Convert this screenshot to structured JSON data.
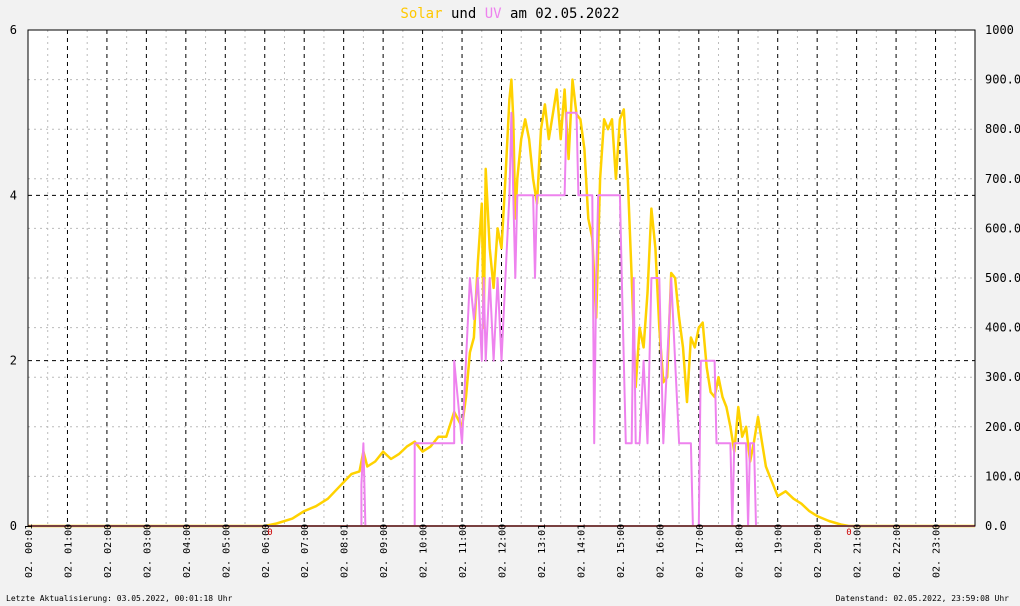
{
  "title": {
    "part1": "Solar",
    "part2": "und",
    "part3": "UV",
    "part4": "am 02.05.2022"
  },
  "footer": {
    "left": "Letzte Aktualisierung: 03.05.2022, 00:01:18 Uhr",
    "right": "Datenstand: 02.05.2022, 23:59:08 Uhr"
  },
  "colors": {
    "solar": "#ffd200",
    "uv": "#ee82ee",
    "title_solar": "#ffc800",
    "title_uv": "#ee82ee",
    "zero_marker": "#cc0000"
  },
  "chart_data": {
    "type": "line",
    "x_unit": "hours",
    "xlim": [
      0,
      24
    ],
    "x_tick_labels": [
      "02. 00:01",
      "02. 01:00",
      "02. 02:00",
      "02. 03:00",
      "02. 04:00",
      "02. 05:00",
      "02. 06:00",
      "02. 07:00",
      "02. 08:01",
      "02. 09:00",
      "02. 10:00",
      "02. 11:00",
      "02. 12:00",
      "02. 13:01",
      "02. 14:01",
      "02. 15:00",
      "02. 16:00",
      "02. 17:00",
      "02. 18:00",
      "02. 19:00",
      "02. 20:00",
      "02. 21:00",
      "02. 22:00",
      "02. 23:00"
    ],
    "y_left": {
      "lim": [
        0,
        6
      ],
      "ticks": [
        "0",
        "2",
        "4",
        "6"
      ]
    },
    "y_right": {
      "lim": [
        0,
        1000
      ],
      "ticks": [
        "0.0",
        "100.0",
        "200.0",
        "300.0",
        "400.0",
        "500.0",
        "600.0",
        "700.0",
        "800.0",
        "900.0",
        "1000"
      ]
    },
    "grid": true,
    "zero_markers": [
      "0",
      "0"
    ],
    "series": [
      {
        "name": "Solar",
        "axis": "right",
        "color": "#ffd200",
        "points": [
          [
            0,
            0
          ],
          [
            6.0,
            0
          ],
          [
            6.3,
            5
          ],
          [
            6.7,
            15
          ],
          [
            7.0,
            30
          ],
          [
            7.3,
            40
          ],
          [
            7.6,
            55
          ],
          [
            7.9,
            80
          ],
          [
            8.2,
            105
          ],
          [
            8.4,
            110
          ],
          [
            8.5,
            150
          ],
          [
            8.6,
            120
          ],
          [
            8.8,
            130
          ],
          [
            9.0,
            150
          ],
          [
            9.2,
            135
          ],
          [
            9.4,
            145
          ],
          [
            9.6,
            160
          ],
          [
            9.8,
            170
          ],
          [
            10.0,
            150
          ],
          [
            10.2,
            160
          ],
          [
            10.4,
            180
          ],
          [
            10.6,
            180
          ],
          [
            10.8,
            230
          ],
          [
            11.0,
            200
          ],
          [
            11.1,
            260
          ],
          [
            11.2,
            350
          ],
          [
            11.3,
            380
          ],
          [
            11.4,
            530
          ],
          [
            11.5,
            650
          ],
          [
            11.55,
            400
          ],
          [
            11.6,
            720
          ],
          [
            11.7,
            560
          ],
          [
            11.8,
            480
          ],
          [
            11.9,
            600
          ],
          [
            12.0,
            560
          ],
          [
            12.1,
            700
          ],
          [
            12.2,
            860
          ],
          [
            12.25,
            900
          ],
          [
            12.3,
            820
          ],
          [
            12.35,
            620
          ],
          [
            12.4,
            700
          ],
          [
            12.5,
            780
          ],
          [
            12.6,
            820
          ],
          [
            12.7,
            780
          ],
          [
            12.8,
            700
          ],
          [
            12.9,
            650
          ],
          [
            13.0,
            800
          ],
          [
            13.1,
            850
          ],
          [
            13.2,
            780
          ],
          [
            13.3,
            830
          ],
          [
            13.4,
            880
          ],
          [
            13.5,
            780
          ],
          [
            13.6,
            880
          ],
          [
            13.7,
            740
          ],
          [
            13.8,
            900
          ],
          [
            13.9,
            830
          ],
          [
            14.0,
            820
          ],
          [
            14.1,
            760
          ],
          [
            14.2,
            620
          ],
          [
            14.3,
            580
          ],
          [
            14.4,
            420
          ],
          [
            14.5,
            700
          ],
          [
            14.6,
            820
          ],
          [
            14.7,
            800
          ],
          [
            14.8,
            820
          ],
          [
            14.9,
            700
          ],
          [
            15.0,
            820
          ],
          [
            15.1,
            840
          ],
          [
            15.2,
            700
          ],
          [
            15.3,
            500
          ],
          [
            15.4,
            280
          ],
          [
            15.5,
            400
          ],
          [
            15.6,
            360
          ],
          [
            15.7,
            470
          ],
          [
            15.8,
            640
          ],
          [
            15.9,
            560
          ],
          [
            16.0,
            400
          ],
          [
            16.1,
            290
          ],
          [
            16.2,
            300
          ],
          [
            16.3,
            510
          ],
          [
            16.4,
            500
          ],
          [
            16.5,
            420
          ],
          [
            16.6,
            360
          ],
          [
            16.7,
            250
          ],
          [
            16.8,
            380
          ],
          [
            16.9,
            360
          ],
          [
            17.0,
            400
          ],
          [
            17.1,
            410
          ],
          [
            17.2,
            320
          ],
          [
            17.3,
            270
          ],
          [
            17.4,
            260
          ],
          [
            17.5,
            300
          ],
          [
            17.6,
            260
          ],
          [
            17.7,
            240
          ],
          [
            17.8,
            200
          ],
          [
            17.9,
            150
          ],
          [
            18.0,
            240
          ],
          [
            18.1,
            180
          ],
          [
            18.2,
            200
          ],
          [
            18.3,
            130
          ],
          [
            18.4,
            170
          ],
          [
            18.5,
            220
          ],
          [
            18.6,
            170
          ],
          [
            18.7,
            120
          ],
          [
            18.8,
            100
          ],
          [
            18.9,
            80
          ],
          [
            19.0,
            60
          ],
          [
            19.2,
            70
          ],
          [
            19.4,
            55
          ],
          [
            19.6,
            45
          ],
          [
            19.8,
            30
          ],
          [
            20.0,
            20
          ],
          [
            20.3,
            10
          ],
          [
            20.6,
            3
          ],
          [
            20.8,
            0
          ],
          [
            24,
            0
          ]
        ]
      },
      {
        "name": "UV",
        "axis": "left",
        "color": "#ee82ee",
        "points": [
          [
            0,
            0
          ],
          [
            8.45,
            0
          ],
          [
            8.45,
            0.5
          ],
          [
            8.5,
            1.0
          ],
          [
            8.55,
            0
          ],
          [
            9.8,
            0
          ],
          [
            9.8,
            1.0
          ],
          [
            10.8,
            1.0
          ],
          [
            10.8,
            2.0
          ],
          [
            11.0,
            1.0
          ],
          [
            11.1,
            2.0
          ],
          [
            11.2,
            3.0
          ],
          [
            11.3,
            2.5
          ],
          [
            11.4,
            3.0
          ],
          [
            11.5,
            2.0
          ],
          [
            11.55,
            3.0
          ],
          [
            11.6,
            2.0
          ],
          [
            11.7,
            3.0
          ],
          [
            11.8,
            2.0
          ],
          [
            11.9,
            3.0
          ],
          [
            12.0,
            2.0
          ],
          [
            12.1,
            3.0
          ],
          [
            12.2,
            4.0
          ],
          [
            12.25,
            5.0
          ],
          [
            12.3,
            4.0
          ],
          [
            12.35,
            3.0
          ],
          [
            12.4,
            4.0
          ],
          [
            12.8,
            4.0
          ],
          [
            12.85,
            3.0
          ],
          [
            12.9,
            4.0
          ],
          [
            13.6,
            4.0
          ],
          [
            13.65,
            5.0
          ],
          [
            13.9,
            5.0
          ],
          [
            13.95,
            4.0
          ],
          [
            14.3,
            4.0
          ],
          [
            14.35,
            1.0
          ],
          [
            14.4,
            3.0
          ],
          [
            14.45,
            4.0
          ],
          [
            15.0,
            4.0
          ],
          [
            15.05,
            3.0
          ],
          [
            15.1,
            2.0
          ],
          [
            15.15,
            1.0
          ],
          [
            15.3,
            1.0
          ],
          [
            15.35,
            3.0
          ],
          [
            15.4,
            1.0
          ],
          [
            15.5,
            1.0
          ],
          [
            15.6,
            2.0
          ],
          [
            15.7,
            1.0
          ],
          [
            15.8,
            3.0
          ],
          [
            16.0,
            3.0
          ],
          [
            16.05,
            2.0
          ],
          [
            16.1,
            1.0
          ],
          [
            16.2,
            2.0
          ],
          [
            16.3,
            3.0
          ],
          [
            16.4,
            2.0
          ],
          [
            16.5,
            1.0
          ],
          [
            16.8,
            1.0
          ],
          [
            16.85,
            0
          ],
          [
            17.0,
            0
          ],
          [
            17.05,
            2.0
          ],
          [
            17.4,
            2.0
          ],
          [
            17.45,
            1.0
          ],
          [
            17.8,
            1.0
          ],
          [
            17.85,
            0
          ],
          [
            17.9,
            1.0
          ],
          [
            18.2,
            1.0
          ],
          [
            18.25,
            0
          ],
          [
            18.3,
            1.0
          ],
          [
            18.4,
            1.0
          ],
          [
            18.45,
            0
          ],
          [
            24,
            0
          ]
        ]
      }
    ]
  }
}
